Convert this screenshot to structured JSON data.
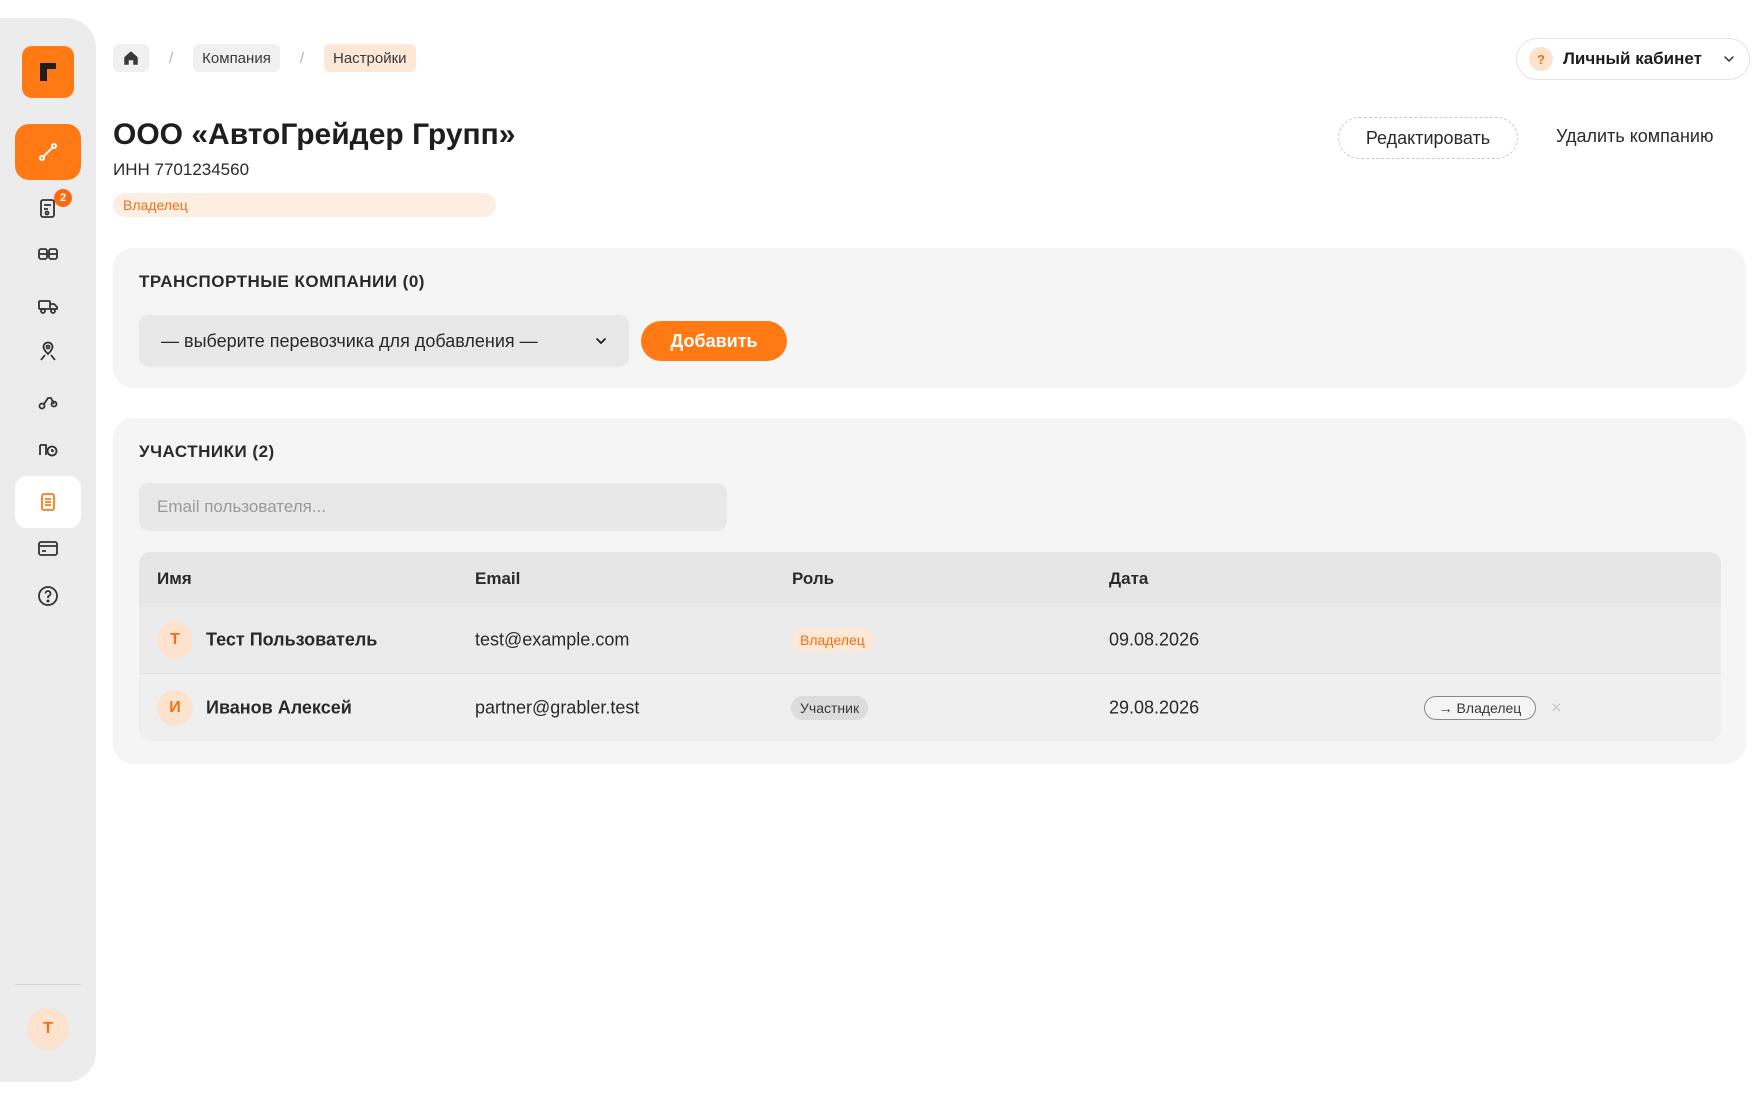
{
  "sidebar": {
    "badge_count": "2",
    "user_initial": "Т",
    "items": [
      {
        "name": "routes",
        "icon": "route-icon",
        "active": true
      },
      {
        "name": "orders",
        "icon": "document-icon"
      },
      {
        "name": "vehicles",
        "icon": "cards-icon"
      },
      {
        "name": "trucks",
        "icon": "truck-icon"
      },
      {
        "name": "locations",
        "icon": "map-pin-icon"
      },
      {
        "name": "tracks",
        "icon": "scooter-icon"
      },
      {
        "name": "timeline",
        "icon": "clock-icon"
      },
      {
        "name": "company",
        "icon": "company-doc-icon",
        "selected": true
      },
      {
        "name": "payments",
        "icon": "card-icon"
      },
      {
        "name": "help",
        "icon": "help-icon"
      }
    ]
  },
  "breadcrumb": {
    "items": [
      "Компания",
      "Настройки"
    ]
  },
  "account": {
    "label": "Личный кабинет",
    "help_mark": "?"
  },
  "company": {
    "title": "ООО «АвтоГрейдер Групп»",
    "inn": "ИНН 7701234560",
    "role": "Владелец",
    "edit_label": "Редактировать",
    "delete_label": "Удалить компанию"
  },
  "carriers": {
    "title": "ТРАНСПОРТНЫЕ КОМПАНИИ (0)",
    "select_value": "— выберите перевозчика для добавления —",
    "add_label": "Добавить"
  },
  "members": {
    "title": "УЧАСТНИКИ (2)",
    "email_placeholder": "Email пользователя...",
    "columns": {
      "name": "Имя",
      "email": "Email",
      "role": "Роль",
      "date": "Дата"
    },
    "rows": [
      {
        "initial": "Т",
        "name": "Тест Пользователь",
        "email": "test@example.com",
        "role": "Владелец",
        "date": "09.08.2026"
      },
      {
        "initial": "И",
        "name": "Иванов Алексей",
        "email": "partner@grabler.test",
        "role": "Участник",
        "date": "29.08.2026",
        "promote_label": "→ Владелец",
        "remove_mark": "×"
      }
    ]
  },
  "colors": {
    "accent": "#ff7a14",
    "accent_soft": "#fde7d7"
  }
}
